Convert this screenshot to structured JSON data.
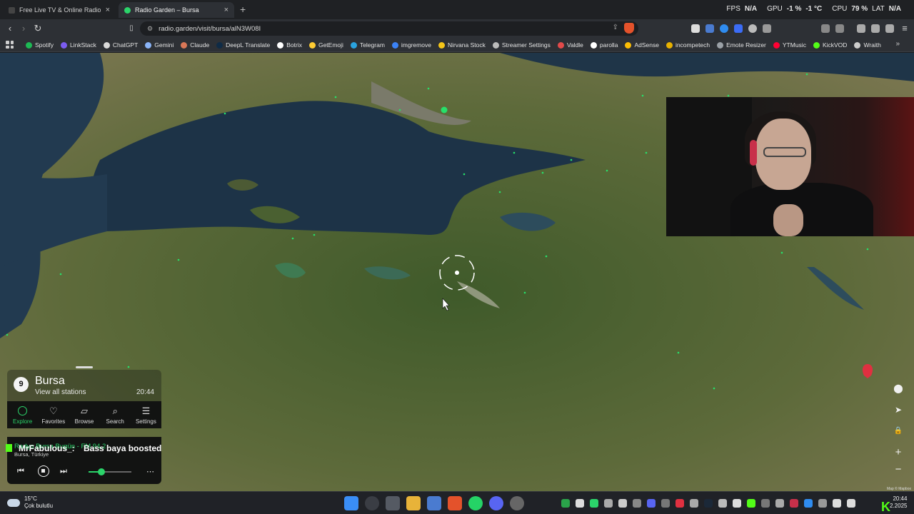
{
  "browser": {
    "tabs": [
      {
        "label": "Free Live TV & Online Radio Wo",
        "active": false
      },
      {
        "label": "Radio Garden – Bursa",
        "active": true
      }
    ],
    "new_tab": "+",
    "close_glyph": "×",
    "url": "radio.garden/visit/bursa/alN3W08I",
    "stats": {
      "fps_label": "FPS",
      "fps_value": "N/A",
      "gpu_label": "GPU",
      "gpu_value": "-1 %",
      "gpu_temp": "-1 °C",
      "cpu_label": "CPU",
      "cpu_value": "79 %",
      "lat_label": "LAT",
      "lat_value": "N/A"
    },
    "bookmarks": [
      {
        "label": "Spotify",
        "color": "#1db954"
      },
      {
        "label": "LinkStack",
        "color": "#7b5cf0"
      },
      {
        "label": "ChatGPT",
        "color": "#d9d9d9"
      },
      {
        "label": "Gemini",
        "color": "#8ab4f8"
      },
      {
        "label": "Claude",
        "color": "#d97757"
      },
      {
        "label": "DeepL Translate",
        "color": "#0f2b46"
      },
      {
        "label": "Botrix",
        "color": "#ffffff"
      },
      {
        "label": "GetEmoji",
        "color": "#ffcc33"
      },
      {
        "label": "Telegram",
        "color": "#2aa3df"
      },
      {
        "label": "imgremove",
        "color": "#3b82f6"
      },
      {
        "label": "Nirvana Stock",
        "color": "#f5c518"
      },
      {
        "label": "Streamer Settings",
        "color": "#bbbbbb"
      },
      {
        "label": "Valdle",
        "color": "#e24a4a"
      },
      {
        "label": "parolla",
        "color": "#ffffff"
      },
      {
        "label": "AdSense",
        "color": "#fbbc04"
      },
      {
        "label": "incompetech",
        "color": "#e8b100"
      },
      {
        "label": "Emote Resizer",
        "color": "#9aa0a6"
      },
      {
        "label": "YTMusic",
        "color": "#ff0033"
      },
      {
        "label": "KickVOD",
        "color": "#53fc18"
      },
      {
        "label": "Wraith",
        "color": "#cccccc"
      }
    ],
    "more_glyph": "»"
  },
  "radio": {
    "station_count": "9",
    "city": "Bursa",
    "view_all": "View all stations",
    "local_time": "20:44",
    "nav": [
      {
        "label": "Explore",
        "icon": "explore-icon",
        "active": true
      },
      {
        "label": "Favorites",
        "icon": "heart-icon",
        "active": false
      },
      {
        "label": "Browse",
        "icon": "map-icon",
        "active": false
      },
      {
        "label": "Search",
        "icon": "search-icon",
        "active": false
      },
      {
        "label": "Settings",
        "icon": "menu-icon",
        "active": false
      }
    ],
    "player": {
      "now_playing": "Radyo Bursa Bugün - FM 94.2",
      "location": "Bursa, Türkiye",
      "chat_name": "MrFabulous_:",
      "chat_message": "Bass baya boosted",
      "volume": 0.3
    },
    "glyphs": {
      "prev": "⏮",
      "next": "⏭",
      "more": "⋯"
    }
  },
  "map_tools": [
    "location-icon",
    "navigate-icon",
    "lock-icon",
    "zoom-in-icon",
    "zoom-out-icon"
  ],
  "tool_glyphs": {
    "location": "⬤",
    "navigate": "➤",
    "lock": "🔒",
    "zoom_in": "+",
    "zoom_out": "−"
  },
  "attribution": "Map © Mapbox",
  "taskbar": {
    "temperature": "15°C",
    "weather_desc": "Çok bulutlu",
    "time": "20:44",
    "date": "2.2025",
    "kick_logo": "K"
  }
}
